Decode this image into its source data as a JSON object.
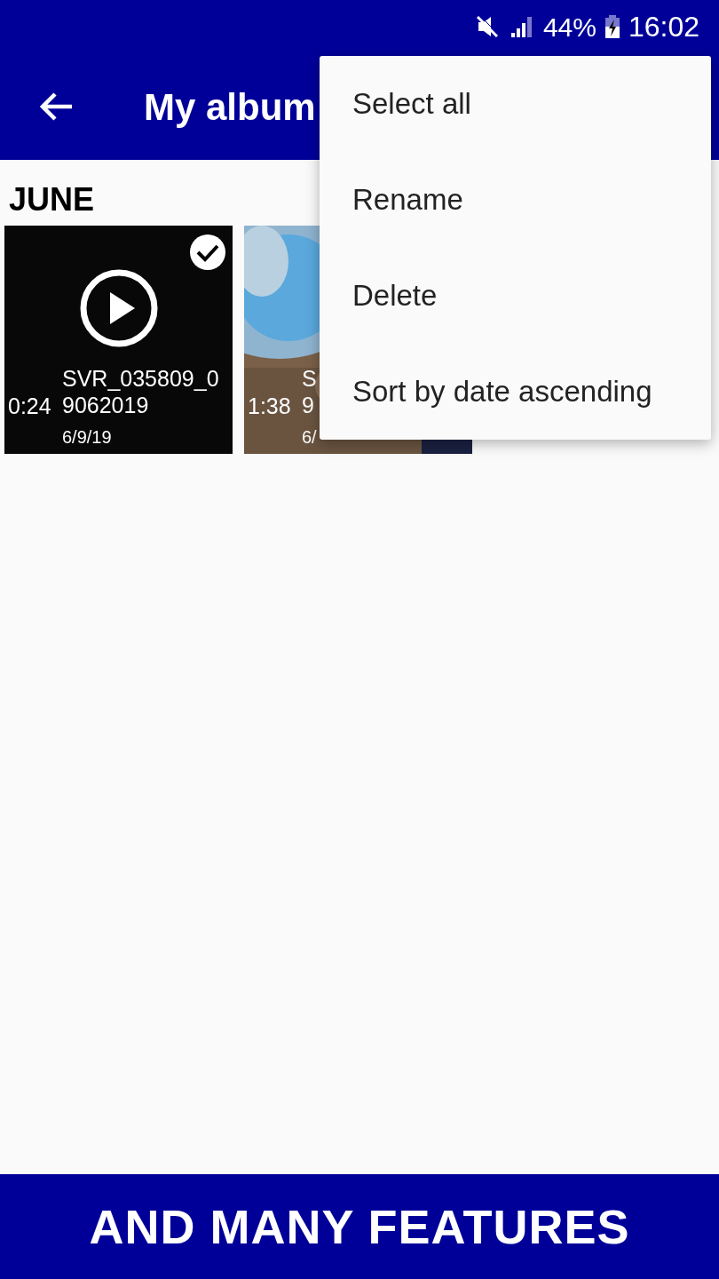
{
  "status_bar": {
    "battery": "44%",
    "time": "16:02"
  },
  "app_bar": {
    "title": "My album"
  },
  "section": {
    "title": "JUNE"
  },
  "videos": [
    {
      "kind": "placeholder",
      "selected": true,
      "duration": "0:24",
      "name_lines": [
        "SVR_035809_0",
        "9062019"
      ],
      "date": "6/9/19"
    },
    {
      "kind": "picture",
      "duration": "1:38",
      "name_lines": [
        "S",
        "9"
      ],
      "date": "6/"
    }
  ],
  "menu": {
    "items": [
      "Select all",
      "Rename",
      "Delete",
      "Sort by date ascending"
    ]
  },
  "banner": {
    "text": "AND MANY FEATURES"
  }
}
